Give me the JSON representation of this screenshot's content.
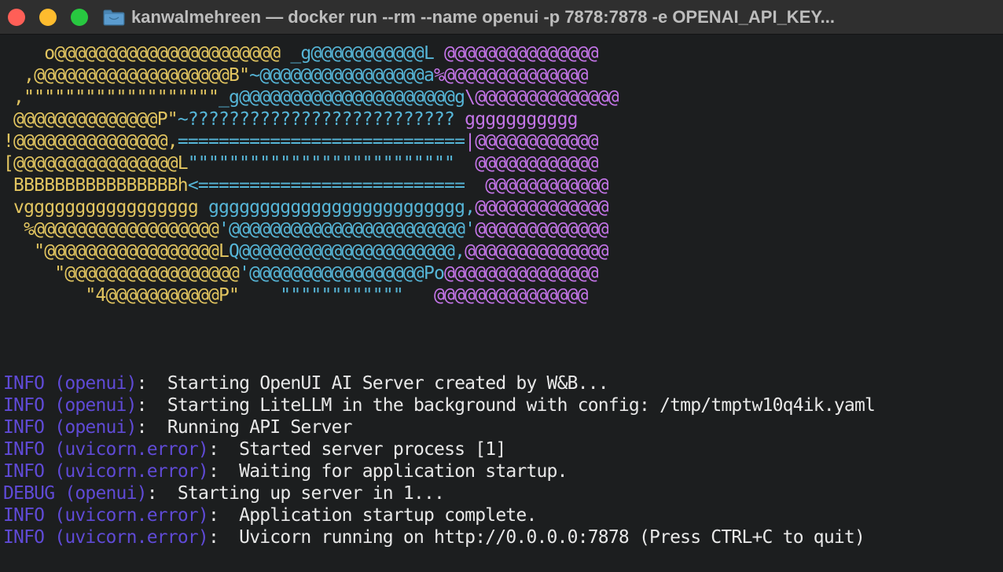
{
  "window": {
    "title": "kanwalmehreen — docker run --rm --name openui -p 7878:7878 -e OPENAI_API_KEY...",
    "traffic_lights": {
      "close_color": "#ff5f57",
      "minimize_color": "#febc2e",
      "zoom_color": "#28c840"
    },
    "folder_icon": "folder-icon"
  },
  "colors": {
    "yellow": "#e2c560",
    "cyan": "#56b6d8",
    "magenta": "#c475e8",
    "log_level": "#5f4ad6",
    "text": "#e8e8e8",
    "cursor": "#9a9a9a"
  },
  "banner": [
    [
      [
        "y",
        "    o@@@@@@@@@@@@@@@@@@@@@@ "
      ],
      [
        "c",
        "_g@@@@@@@@@@@L "
      ],
      [
        "m",
        "@@@@@@@@@@@@@@@"
      ]
    ],
    [
      [
        "y",
        "  ,@@@@@@@@@@@@@@@@@@@B\""
      ],
      [
        "c",
        "~@@@@@@@@@@@@@@@@a"
      ],
      [
        "m",
        "%@@@@@@@@@@@@@@"
      ]
    ],
    [
      [
        "y",
        " ,\"\"\"\"\"\"\"\"\"\"\"\"\"\"\"\"\"\"\""
      ],
      [
        "c",
        "_g@@@@@@@@@@@@@@@@@@@@@g"
      ],
      [
        "m",
        "\\@@@@@@@@@@@@@@"
      ]
    ],
    [
      [
        "y",
        " @@@@@@@@@@@@@@P\""
      ],
      [
        "c",
        "~?????????????????????????? "
      ],
      [
        "m",
        "ggggggggggg"
      ]
    ],
    [
      [
        "y",
        "!@@@@@@@@@@@@@@@,"
      ],
      [
        "c",
        "============================"
      ],
      [
        "m",
        "|@@@@@@@@@@@@"
      ]
    ],
    [
      [
        "y",
        "[@@@@@@@@@@@@@@@@L"
      ],
      [
        "c",
        "\"\"\"\"\"\"\"\"\"\"\"\"\"\"\"\"\"\"\"\"\"\"\"\"\"\" "
      ],
      [
        "m",
        " @@@@@@@@@@@@"
      ]
    ],
    [
      [
        "y",
        " BBBBBBBBBBBBBBBBh"
      ],
      [
        "c",
        "<========================== "
      ],
      [
        "m",
        " @@@@@@@@@@@@"
      ]
    ],
    [
      [
        "y",
        " vggggggggggggggggg "
      ],
      [
        "c",
        "ggggggggggggggggggggggggg,"
      ],
      [
        "m",
        "@@@@@@@@@@@@@"
      ]
    ],
    [
      [
        "y",
        "  %@@@@@@@@@@@@@@@@@@"
      ],
      [
        "c",
        "'@@@@@@@@@@@@@@@@@@@@@@@'"
      ],
      [
        "m",
        "@@@@@@@@@@@@@"
      ]
    ],
    [
      [
        "y",
        "   \"@@@@@@@@@@@@@@@@@L"
      ],
      [
        "c",
        "Q@@@@@@@@@@@@@@@@@@@@@,"
      ],
      [
        "m",
        "@@@@@@@@@@@@@@"
      ]
    ],
    [
      [
        "y",
        "     \"@@@@@@@@@@@@@@@@@"
      ],
      [
        "c",
        "'@@@@@@@@@@@@@@@@@Po"
      ],
      [
        "m",
        "@@@@@@@@@@@@@@@"
      ]
    ],
    [
      [
        "y",
        "        \"4@@@@@@@@@@@P\"    "
      ],
      [
        "c",
        "\"\"\"\"\"\"\"\"\"\"\"\"   "
      ],
      [
        "m",
        "@@@@@@@@@@@@@@@"
      ]
    ]
  ],
  "logs": [
    {
      "level": "INFO",
      "source": "(openui)",
      "sep": ":  ",
      "message": "Starting OpenUI AI Server created by W&B..."
    },
    {
      "level": "INFO",
      "source": "(openui)",
      "sep": ":  ",
      "message": "Starting LiteLLM in the background with config: /tmp/tmptw10q4ik.yaml"
    },
    {
      "level": "INFO",
      "source": "(openui)",
      "sep": ":  ",
      "message": "Running API Server"
    },
    {
      "level": "INFO",
      "source": "(uvicorn.error)",
      "sep": ":  ",
      "message": "Started server process [1]"
    },
    {
      "level": "INFO",
      "source": "(uvicorn.error)",
      "sep": ":  ",
      "message": "Waiting for application startup."
    },
    {
      "level": "DEBUG",
      "source": "(openui)",
      "sep": ":  ",
      "message": "Starting up server in 1..."
    },
    {
      "level": "INFO",
      "source": "(uvicorn.error)",
      "sep": ":  ",
      "message": "Application startup complete."
    },
    {
      "level": "INFO",
      "source": "(uvicorn.error)",
      "sep": ":  ",
      "message": "Uvicorn running on http://0.0.0.0:7878 (Press CTRL+C to quit)"
    }
  ]
}
